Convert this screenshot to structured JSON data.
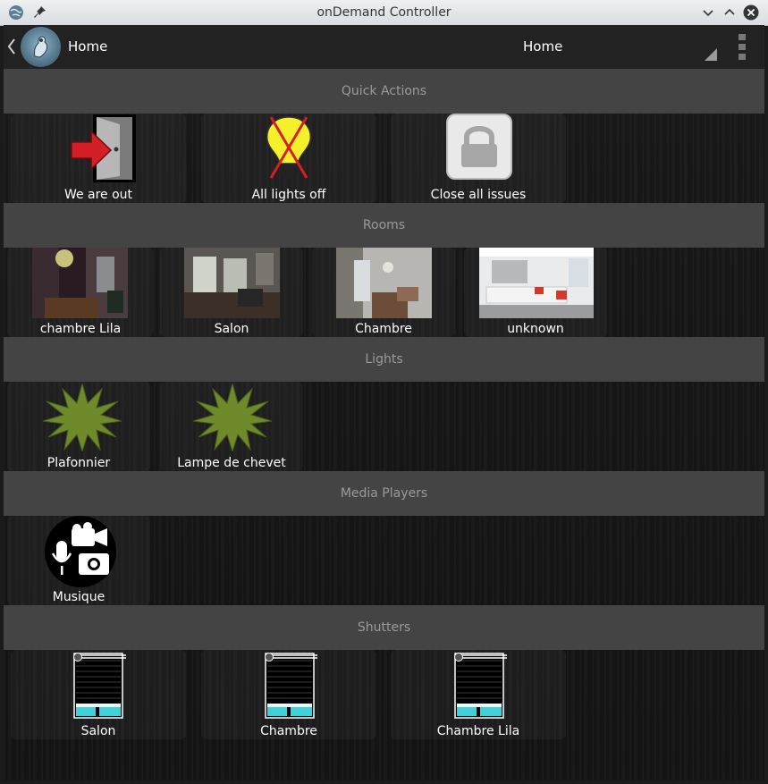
{
  "window": {
    "title": "onDemand Controller"
  },
  "appbar": {
    "home_label": "Home",
    "spinner_value": "Home"
  },
  "sections": {
    "quick_actions": "Quick Actions",
    "rooms": "Rooms",
    "lights": "Lights",
    "media_players": "Media Players",
    "shutters": "Shutters"
  },
  "quick_actions": [
    {
      "label": "We are out",
      "icon": "exit-door-icon"
    },
    {
      "label": "All lights off",
      "icon": "lightbulb-off-icon"
    },
    {
      "label": "Close all issues",
      "icon": "lock-icon"
    }
  ],
  "rooms": [
    {
      "label": "chambre Lila",
      "icon": "room-photo"
    },
    {
      "label": "Salon",
      "icon": "room-photo"
    },
    {
      "label": "Chambre",
      "icon": "room-photo"
    },
    {
      "label": "unknown",
      "icon": "room-photo"
    }
  ],
  "lights": [
    {
      "label": "Plafonnier",
      "icon": "light-starburst-icon"
    },
    {
      "label": "Lampe de chevet",
      "icon": "light-starburst-icon"
    }
  ],
  "media_players": [
    {
      "label": "Musique",
      "icon": "media-player-icon"
    }
  ],
  "shutters": [
    {
      "label": "Salon",
      "icon": "shutter-icon"
    },
    {
      "label": "Chambre",
      "icon": "shutter-icon"
    },
    {
      "label": "Chambre Lila",
      "icon": "shutter-icon"
    }
  ],
  "colors": {
    "section_header_bg": "#444444",
    "section_header_text": "#9a9a9a",
    "light_icon": "#6f8a2a",
    "shutter_glass": "#3fd0d8"
  }
}
